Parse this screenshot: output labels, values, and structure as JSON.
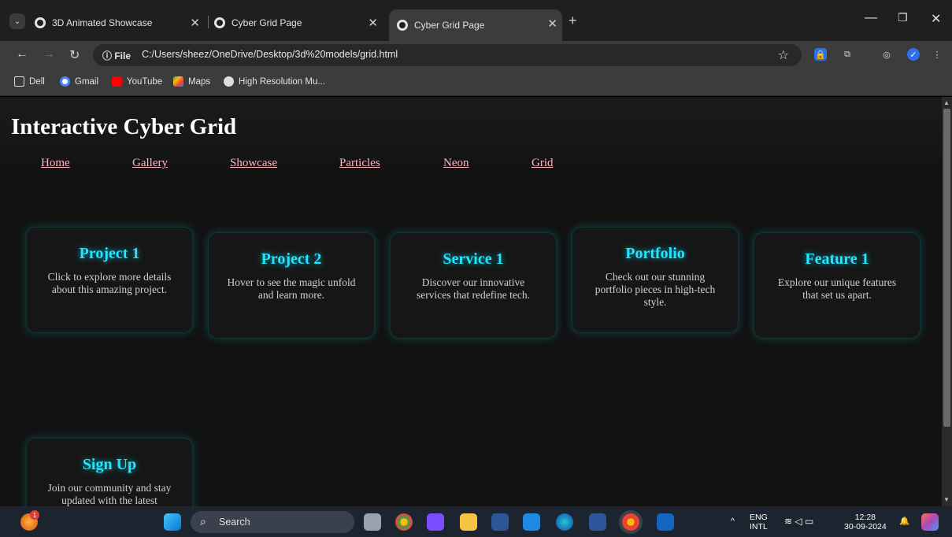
{
  "browser": {
    "tabs": [
      {
        "title": "3D Animated Showcase"
      },
      {
        "title": "Cyber Grid Page"
      },
      {
        "title": "Cyber Grid Page"
      }
    ],
    "url_chip": "File",
    "url": "C:/Users/sheez/OneDrive/Desktop/3d%20models/grid.html",
    "bookmarks": [
      {
        "label": "Dell"
      },
      {
        "label": "Gmail"
      },
      {
        "label": "YouTube"
      },
      {
        "label": "Maps"
      },
      {
        "label": "High Resolution Mu..."
      }
    ]
  },
  "page": {
    "title": "Interactive Cyber Grid",
    "nav": [
      "Home",
      "Gallery",
      "Showcase",
      "Particles",
      "Neon",
      "Grid"
    ],
    "cards": [
      {
        "title": "Project 1",
        "text": "Click to explore more details about this amazing project."
      },
      {
        "title": "Project 2",
        "text": "Hover to see the magic unfold and learn more."
      },
      {
        "title": "Service 1",
        "text": "Discover our innovative services that redefine tech."
      },
      {
        "title": "Portfolio",
        "text": "Check out our stunning portfolio pieces in high-tech style."
      },
      {
        "title": "Feature 1",
        "text": "Explore our unique features that set us apart."
      },
      {
        "title": "Sign Up",
        "text": "Join our community and stay updated with the latest"
      }
    ],
    "colors": {
      "background": "#121212",
      "card_title": "#22e6ff",
      "nav_link": "#ffb6c1",
      "heading": "#ffffff"
    }
  },
  "taskbar": {
    "search_label": "Search",
    "notification_count": "1",
    "lang_top": "ENG",
    "lang_bottom": "INTL",
    "time": "12:28",
    "date": "30-09-2024"
  }
}
